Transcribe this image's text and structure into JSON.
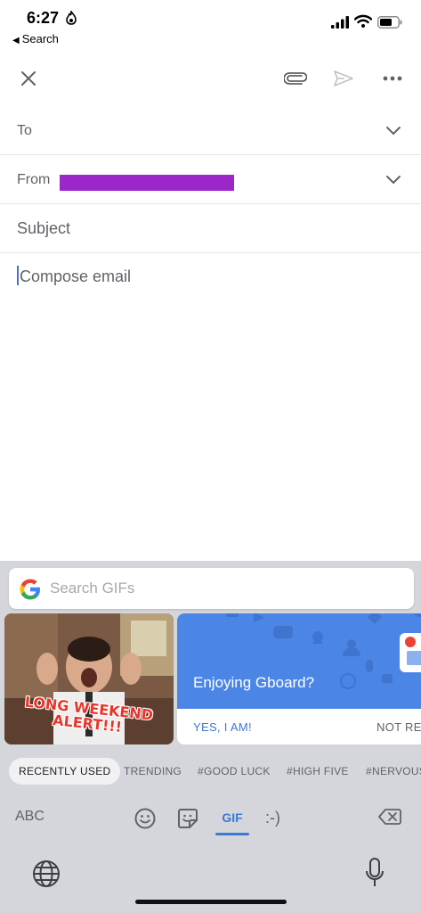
{
  "status_bar": {
    "time": "6:27",
    "back_label": "Search"
  },
  "toolbar": {
    "close_icon": "close-icon",
    "attach_icon": "paperclip-icon",
    "send_icon": "send-icon",
    "more_icon": "more-horizontal-icon"
  },
  "fields": {
    "to_label": "To",
    "from_label": "From",
    "subject_placeholder": "Subject",
    "body_placeholder": "Compose email"
  },
  "colors": {
    "redaction": "#9b27c9",
    "accent": "#3c78d8",
    "promo_bg": "#4b86e6",
    "keyboard_bg": "#d5d6dc"
  },
  "keyboard": {
    "search_placeholder": "Search GIFs",
    "gif_caption_line1": "LONG WEEKEND",
    "gif_caption_line2": "ALERT!!!",
    "promo": {
      "title": "Enjoying Gboard?",
      "yes_label": "YES, I AM!",
      "no_label": "NOT RE"
    },
    "categories": [
      "RECENTLY USED",
      "TRENDING",
      "#GOOD LUCK",
      "#HIGH FIVE",
      "#NERVOUS"
    ],
    "active_category": "RECENTLY USED",
    "modes": {
      "abc": "ABC",
      "gif": "GIF",
      "emoticon": ":-)"
    }
  }
}
